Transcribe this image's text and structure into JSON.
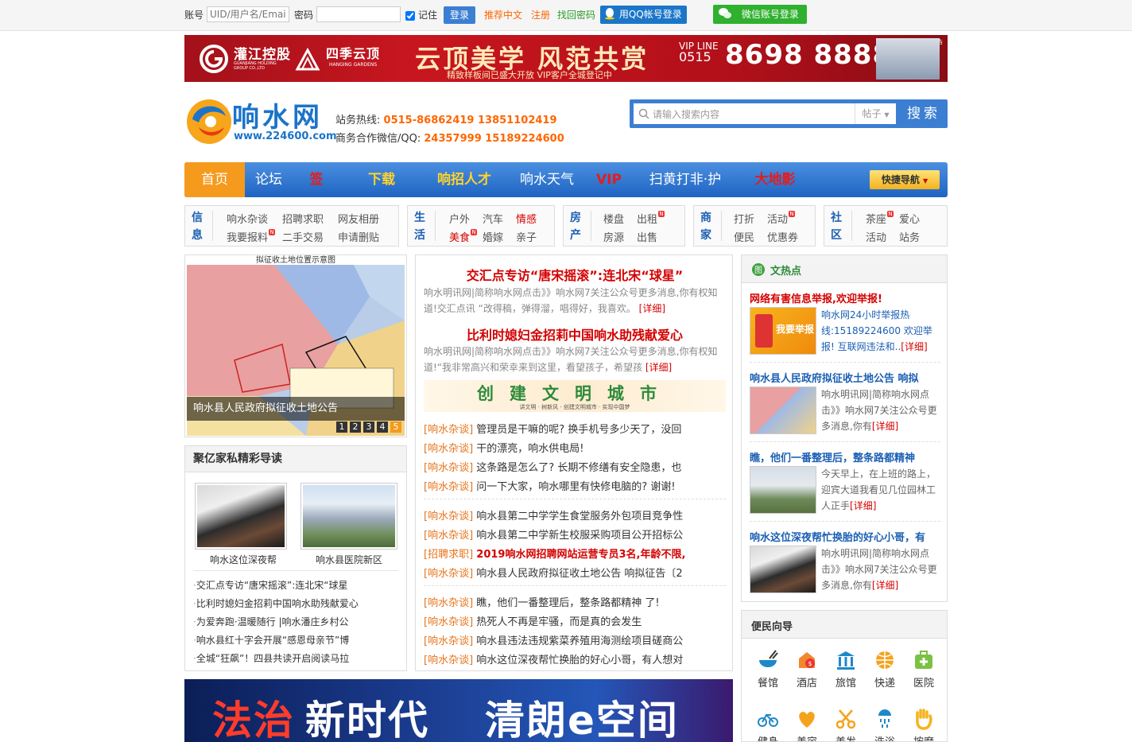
{
  "topbar": {
    "account_label": "账号",
    "account_placeholder": "UID/用户名/Email",
    "password_label": "密码",
    "remember_label": "记住",
    "login_button": "登录",
    "recommend_cn": "推荐中文",
    "register": "注册",
    "retrieve_pwd": "找回密码",
    "qq_login": "用QQ帐号登录",
    "wechat_login": "微信账号登录"
  },
  "ad_top": {
    "brand1": "灌江控股",
    "brand1_en": "GUANJIANG HOLDING GROUP CO.,LTD",
    "brand2": "四季云顶",
    "brand2_en": "HANGING GARDENS",
    "slogan": "云顶美学 风范共赏",
    "sub": "精致样板间已盛大开放 VIP客户全城登记中",
    "vip_line": "VIP LINE",
    "area_code": "0515",
    "phone": "8698 8888",
    "ad_mark": "广告"
  },
  "header": {
    "logo_text": "响水网",
    "logo_url": "www.224600.com",
    "hotline_label": "站务热线:",
    "hotline": "0515-86862419 13851102419",
    "biz_label": "商务合作微信/QQ:",
    "biz": "24357999 15189224600"
  },
  "search": {
    "placeholder": "请输入搜索内容",
    "category": "帖子",
    "button": "搜索"
  },
  "nav": {
    "items": [
      {
        "label": "首页",
        "color": "#ffffff"
      },
      {
        "label": "论坛",
        "color": "#ffffff"
      },
      {
        "label": "签到",
        "color": "#e61c1c"
      },
      {
        "label": "下载APP",
        "color": "#ffd32a"
      },
      {
        "label": "响招人才网",
        "color": "#ffd32a"
      },
      {
        "label": "响水天气",
        "color": "#ffffff"
      },
      {
        "label": "VIP",
        "color": "#e61c1c"
      },
      {
        "label": "扫黄打非·护苗",
        "color": "#ffffff"
      },
      {
        "label": "大地影城",
        "color": "#e61c1c"
      }
    ],
    "quick_nav": "快捷导航"
  },
  "categories": [
    {
      "head": [
        "信",
        "息"
      ],
      "items": [
        "响水杂谈",
        "招聘求职",
        "网友相册",
        "我要报料",
        "二手交易",
        "申请删贴"
      ]
    },
    {
      "head": [
        "生",
        "活"
      ],
      "items": [
        "户外",
        "汽车",
        "情感",
        "美食",
        "婚嫁",
        "亲子"
      ]
    },
    {
      "head": [
        "房",
        "产"
      ],
      "items": [
        "楼盘",
        "出租",
        "房源",
        "出售"
      ]
    },
    {
      "head": [
        "商",
        "家"
      ],
      "items": [
        "打折",
        "活动",
        "便民",
        "优惠券"
      ]
    },
    {
      "head": [
        "社",
        "区"
      ],
      "items": [
        "茶座",
        "爱心",
        "活动",
        "站务"
      ]
    }
  ],
  "slider": {
    "map_title": "拟征收土地位置示意图",
    "caption": "响水县人民政府拟征收土地公告",
    "pages": [
      "1",
      "2",
      "3",
      "4",
      "5"
    ]
  },
  "private_reading": {
    "title": "聚亿家私精彩导读",
    "thumbs": [
      "响水这位深夜帮",
      "响水县医院新区"
    ],
    "links": [
      "交汇点专访“唐宋摇滚”:连北宋“球星",
      "比利时媳妇金招莉中国响水助残献爱心",
      "为爱奔跑·温暖随行 |响水潘庄乡村公",
      "响水县红十字会开展“感恩母亲节”博",
      "全城“狂飙”！四县共读开启阅读马拉"
    ]
  },
  "center": {
    "headline1": "交汇点专访“唐宋摇滚”:连北宋“球星”",
    "summary1": "响水明讯网|简称响水网点击》》响水网7关注公众号更多消息,你有权知道!交汇点讯 “改得稿，弹得溜，唱得好，我喜欢。",
    "headline2": "比利时媳妇金招莉中国响水助残献爱心",
    "summary2": "响水明讯网|简称响水网点击》》响水网7关注公众号更多消息,你有权知道!“我非常高兴和荣幸来到这里，看望孩子，希望孩",
    "detail": "[详细]",
    "civil_banner": "创建文明城市",
    "civil_sub": "讲文明 · 树新风 · 创建文明城市 · 实现中国梦",
    "group1": [
      {
        "tag": "[响水杂谈]",
        "text": "管理员是干嘛的呢? 换手机号多少天了，没回"
      },
      {
        "tag": "[响水杂谈]",
        "text": "干的漂亮，响水供电局!"
      },
      {
        "tag": "[响水杂谈]",
        "text": "这条路是怎么了? 长期不修缮有安全隐患，也"
      },
      {
        "tag": "[响水杂谈]",
        "text": "问一下大家，响水哪里有快修电脑的? 谢谢!"
      }
    ],
    "group2": [
      {
        "tag": "[响水杂谈]",
        "text": "响水县第二中学学生食堂服务外包项目竞争性",
        "red": false
      },
      {
        "tag": "[响水杂谈]",
        "text": "响水县第二中学新生校服采购项目公开招标公",
        "red": false
      },
      {
        "tag": "[招聘求职]",
        "text": "2019响水网招聘网站运营专员3名,年龄不限,",
        "red": true
      },
      {
        "tag": "[响水杂谈]",
        "text": "响水县人民政府拟征收土地公告 响拟征告〔2",
        "red": false
      }
    ],
    "group3": [
      {
        "tag": "[响水杂谈]",
        "text": "瞧，他们一番整理后，整条路都精神 了!"
      },
      {
        "tag": "[响水杂谈]",
        "text": "热死人不再是牢骚，而是真的会发生"
      },
      {
        "tag": "[响水杂谈]",
        "text": "响水县违法违规紫菜养殖用海测绘项目磋商公"
      },
      {
        "tag": "[响水杂谈]",
        "text": "响水这位深夜帮忙换胎的好心小哥，有人想对"
      }
    ]
  },
  "hot": {
    "title": "文热点",
    "item1_title": "网络有害信息举报,欢迎举报!",
    "item1_img_text": "我要举报",
    "item1_text": "响水网24小时举报热线:15189224600 欢迎举报! 互联网违法和..",
    "item2_title": "响水县人民政府拟征收土地公告 响拟",
    "item2_text": "响水明讯网|简称响水网点击》》响水网7关注公众号更多消息,你有",
    "item3_title": "瞧，他们一番整理后，整条路都精神",
    "item3_text": "今天早上，在上班的路上，迎宾大道我看见几位园林工人正手",
    "item4_title": "响水这位深夜帮忙换胎的好心小哥，有",
    "item4_text": "响水明讯网|简称响水网点击》》响水网7关注公众号更多消息,你有",
    "detail": "[详细]"
  },
  "services": {
    "title": "便民向导",
    "items": [
      "餐馆",
      "酒店",
      "旅馆",
      "快递",
      "医院",
      "健身",
      "美容",
      "美发",
      "洗浴",
      "按摩"
    ]
  },
  "banner": {
    "t1": "法治",
    "t2": "新时代",
    "t3": "清朗e空间"
  }
}
